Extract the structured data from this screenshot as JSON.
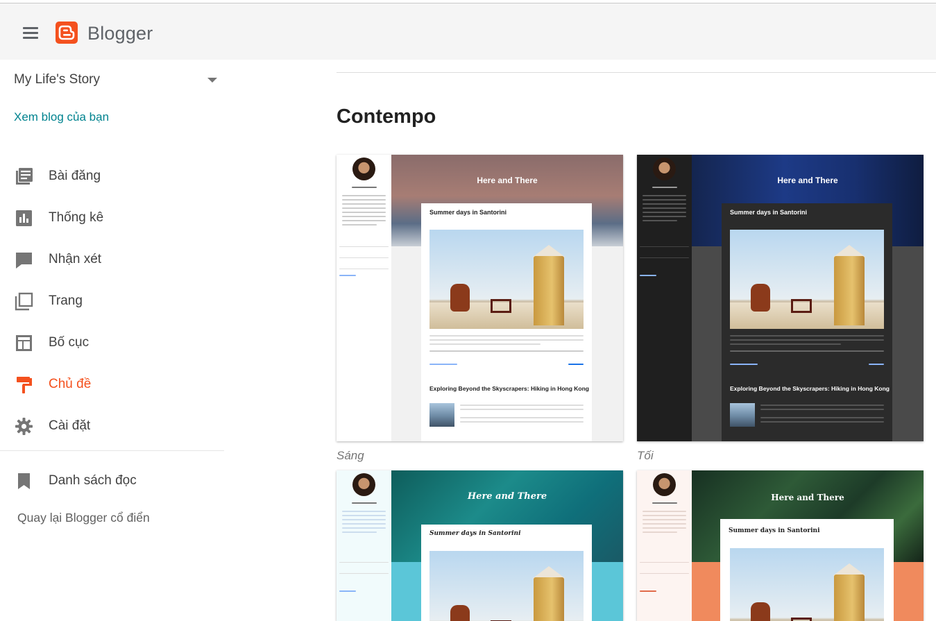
{
  "app": {
    "name": "Blogger"
  },
  "colors": {
    "accent": "#f4511e",
    "link": "#00838f",
    "header_bg": "#f5f5f5"
  },
  "sidebar": {
    "blog_name": "My Life's Story",
    "view_blog": "Xem blog của bạn",
    "items": [
      {
        "label": "Bài đăng",
        "icon": "posts-icon"
      },
      {
        "label": "Thống kê",
        "icon": "stats-icon"
      },
      {
        "label": "Nhận xét",
        "icon": "comments-icon"
      },
      {
        "label": "Trang",
        "icon": "pages-icon"
      },
      {
        "label": "Bố cục",
        "icon": "layout-icon"
      },
      {
        "label": "Chủ đề",
        "icon": "theme-icon",
        "active": true
      },
      {
        "label": "Cài đặt",
        "icon": "settings-icon"
      }
    ],
    "reading_list": {
      "label": "Danh sách đọc",
      "icon": "bookmark-icon"
    },
    "classic_link": "Quay lại Blogger cổ điển"
  },
  "main": {
    "section_title": "Contempo",
    "preview": {
      "blog_title": "Here and There",
      "post1_title": "Summer days in Santorini",
      "post2_title": "Exploring Beyond the Skyscrapers: Hiking in Hong Kong"
    },
    "themes": [
      {
        "caption": "Sáng",
        "variant": "light"
      },
      {
        "caption": "Tối",
        "variant": "dark"
      },
      {
        "caption": "",
        "variant": "aqua"
      },
      {
        "caption": "",
        "variant": "pink"
      }
    ]
  }
}
